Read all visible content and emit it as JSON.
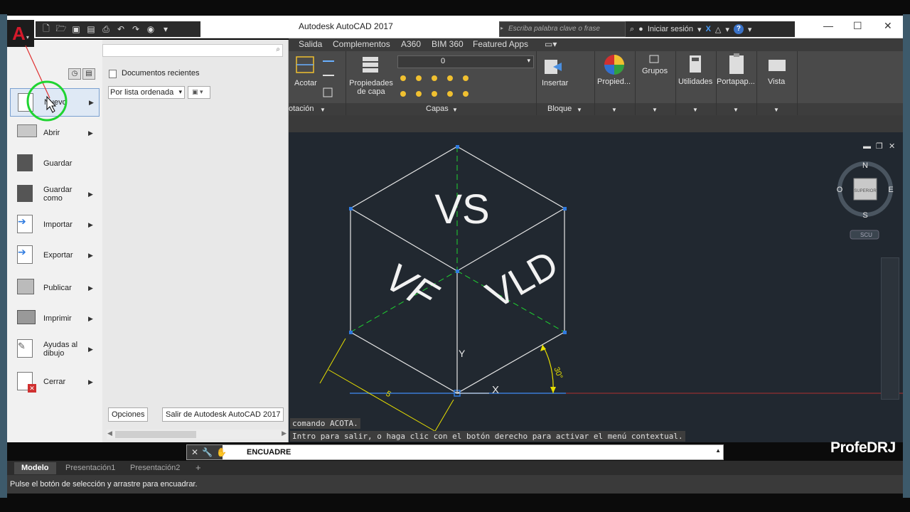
{
  "window": {
    "title": "Autodesk AutoCAD 2017",
    "search_placeholder": "Escriba palabra clave o frase",
    "signin_label": "Iniciar sesión",
    "help_glyph": "?",
    "minimize_glyph": "—",
    "maximize_glyph": "☐",
    "close_glyph": "✕"
  },
  "app_button": {
    "letter": "A"
  },
  "ribbon": {
    "tabs": [
      "Salida",
      "Complementos",
      "A360",
      "BIM 360",
      "Featured Apps"
    ],
    "panels": {
      "acotar_label": "Acotar",
      "anotacion_label": "otación",
      "propiedades_capa_label": "Propiedades de capa",
      "capas_label": "Capas",
      "layer_value": "0",
      "insertar_label": "Insertar",
      "bloque_label": "Bloque",
      "propied_label": "Propied...",
      "grupos_label": "Grupos",
      "utilidades_label": "Utilidades",
      "portapap_label": "Portapap...",
      "vista_label": "Vista"
    }
  },
  "app_menu": {
    "recent_title": "Documentos recientes",
    "sort_combo": "Por lista ordenada",
    "items": [
      {
        "label": "Nuevo",
        "submenu": true
      },
      {
        "label": "Abrir",
        "submenu": true
      },
      {
        "label": "Guardar",
        "submenu": false
      },
      {
        "label": "Guardar como",
        "submenu": true
      },
      {
        "label": "Importar",
        "submenu": true
      },
      {
        "label": "Exportar",
        "submenu": true
      },
      {
        "label": "Publicar",
        "submenu": true
      },
      {
        "label": "Imprimir",
        "submenu": true
      },
      {
        "label": "Ayudas al dibujo",
        "submenu": true
      },
      {
        "label": "Cerrar",
        "submenu": true
      }
    ],
    "options_button": "Opciones",
    "exit_button": "Salir de Autodesk AutoCAD 2017"
  },
  "drawing": {
    "labels": {
      "top": "VS",
      "left": "VF",
      "right": "VLD"
    },
    "angle_label": "30°",
    "dimension_label": "5",
    "axis_y": "Y",
    "axis_x": "X",
    "viewcube": {
      "north": "N",
      "south": "S",
      "east": "E",
      "west": "O",
      "face": "SUPERIOR",
      "ucs": "SCU"
    }
  },
  "command": {
    "line1": "comando ACOTA.",
    "line2": "Intro para salir, o haga clic con el botón derecho para activar el menú contextual.",
    "input_value": "ENCUADRE"
  },
  "watermark": "ProfeDRJ",
  "layout_tabs": [
    "Modelo",
    "Presentación1",
    "Presentación2"
  ],
  "add_tab": "+",
  "status_text": "Pulse el botón de selección y arrastre para encuadrar.",
  "colors": {
    "drawing_bg": "#212830",
    "menu_bg": "#e8e8e8",
    "selection_blue": "#2f7be0",
    "highlight_green": "#1fd431",
    "dim_yellow": "#e8e000",
    "cursor_red": "#e03030"
  }
}
